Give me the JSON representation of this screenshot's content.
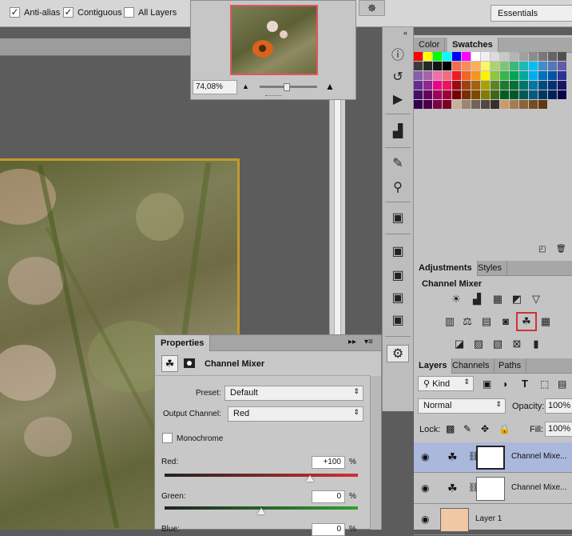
{
  "options": {
    "anti_alias": "Anti-alias",
    "contiguous": "Contiguous",
    "all_layers": "All Layers",
    "workspace": "Essentials"
  },
  "navigator": {
    "zoom": "74,08%"
  },
  "color_panel": {
    "tabs": [
      "Color",
      "Swatches"
    ]
  },
  "adjustments": {
    "tabs": [
      "Adjustments",
      "Styles"
    ],
    "title": "Channel Mixer"
  },
  "layers": {
    "tabs": [
      "Layers",
      "Channels",
      "Paths"
    ],
    "filter": "Kind",
    "blend": "Normal",
    "opacity_label": "Opacity:",
    "opacity": "100%",
    "lock_label": "Lock:",
    "fill_label": "Fill:",
    "fill": "100%",
    "items": [
      {
        "name": "Channel Mixe..."
      },
      {
        "name": "Channel Mixe..."
      },
      {
        "name": "Layer 1"
      }
    ]
  },
  "properties": {
    "tab": "Properties",
    "title": "Channel Mixer",
    "preset_label": "Preset:",
    "preset": "Default",
    "output_label": "Output Channel:",
    "output": "Red",
    "mono_label": "Monochrome",
    "red_label": "Red:",
    "red": "+100",
    "green_label": "Green:",
    "green": "0",
    "blue_label": "Blue:",
    "blue": "0",
    "percent": "%",
    "red_level": 100,
    "green_level": 0
  },
  "colors": {
    "accent_highlight": "#d32f3a",
    "layer_selected": "#aab8dc",
    "canvas_border": "#c39a2e"
  }
}
